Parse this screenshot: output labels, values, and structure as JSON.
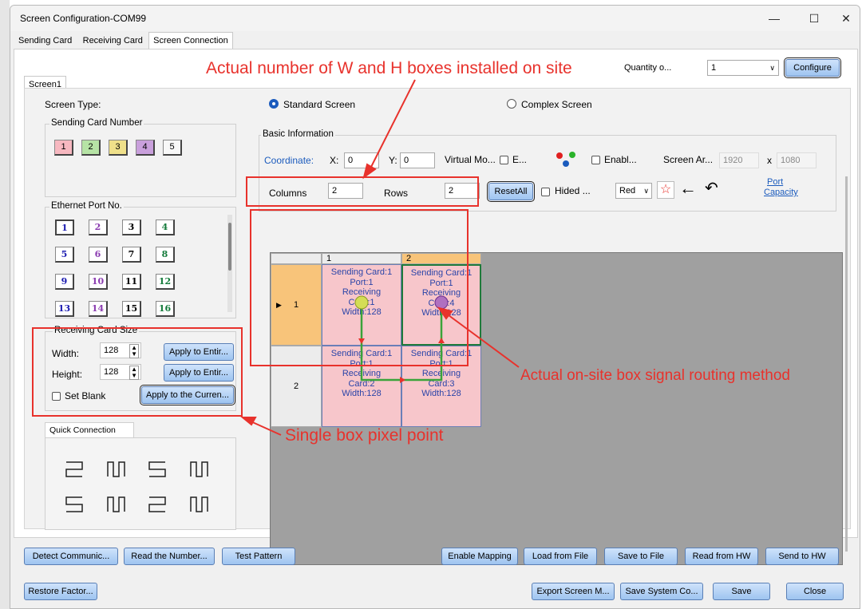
{
  "window": {
    "title": "Screen Configuration-COM99",
    "minimize": "—",
    "maximize": "☐",
    "close": "✕"
  },
  "tabs": [
    "Sending Card",
    "Receiving Card",
    "Screen Connection"
  ],
  "screen_tab": "Screen1",
  "quantity": {
    "label": "Quantity o...",
    "value": "1",
    "configure": "Configure"
  },
  "screen_type": {
    "label": "Screen Type:",
    "standard": "Standard Screen",
    "complex": "Complex Screen"
  },
  "sending_card": {
    "label": "Sending Card Number",
    "items": [
      "1",
      "2",
      "3",
      "4",
      "5"
    ]
  },
  "basic": {
    "label": "Basic Information",
    "coordinate": "Coordinate:",
    "x_label": "X:",
    "x": "0",
    "y_label": "Y:",
    "y": "0",
    "virtual": "Virtual Mo...",
    "e": "E...",
    "enable": "Enabl...",
    "screen_area": "Screen Ar...",
    "width": "1920",
    "x_sep": "x",
    "height": "1080",
    "columns_label": "Columns",
    "columns": "2",
    "rows_label": "Rows",
    "rows": "2",
    "reset_all": "ResetAll",
    "hided": "Hided ...",
    "color": "Red",
    "port_capacity_1": "Port",
    "port_capacity_2": "Capacity"
  },
  "ethernet": {
    "label": "Ethernet Port No.",
    "ports": [
      "1",
      "2",
      "3",
      "4",
      "5",
      "6",
      "7",
      "8",
      "9",
      "10",
      "11",
      "12",
      "13",
      "14",
      "15",
      "16"
    ]
  },
  "rcsize": {
    "label": "Receiving Card Size",
    "width_label": "Width:",
    "width": "128",
    "height_label": "Height:",
    "height": "128",
    "apply1": "Apply to Entir...",
    "apply2": "Apply to Entir...",
    "set_blank": "Set Blank",
    "apply_current": "Apply to the Curren..."
  },
  "quick": {
    "label": "Quick Connection"
  },
  "grid": {
    "col_headers": [
      "1",
      "2"
    ],
    "row_headers": [
      "1",
      "2"
    ],
    "row_marker": "▶",
    "cells": [
      [
        "Sending Card:1",
        "Port:1",
        "Receiving",
        "Card:1",
        "Width:128"
      ],
      [
        "Sending Card:1",
        "Port:1",
        "Receiving",
        "Card:4",
        "Width:128"
      ],
      [
        "Sending Card:1",
        "Port:1",
        "Receiving",
        "Card:2",
        "Width:128"
      ],
      [
        "Sending Card:1",
        "Port:1",
        "Receiving",
        "Card:3",
        "Width:128"
      ]
    ]
  },
  "annotations": {
    "top": "Actual number of W and H boxes installed on site",
    "routing": "Actual on-site box signal routing method",
    "pixel": "Single box pixel point"
  },
  "bottom": {
    "detect": "Detect Communic...",
    "read_number": "Read the Number...",
    "test_pattern": "Test Pattern",
    "enable_mapping": "Enable Mapping",
    "load_file": "Load from File",
    "save_file": "Save to File",
    "read_hw": "Read from HW",
    "send_hw": "Send to HW",
    "restore": "Restore Factor...",
    "export": "Export Screen M...",
    "save_system": "Save System Co...",
    "save": "Save",
    "close": "Close"
  },
  "colors": {
    "accent": "#e8322c",
    "cell": "#f7c6cb",
    "highlight": "#f8c47a",
    "route": "#3aa33a"
  }
}
